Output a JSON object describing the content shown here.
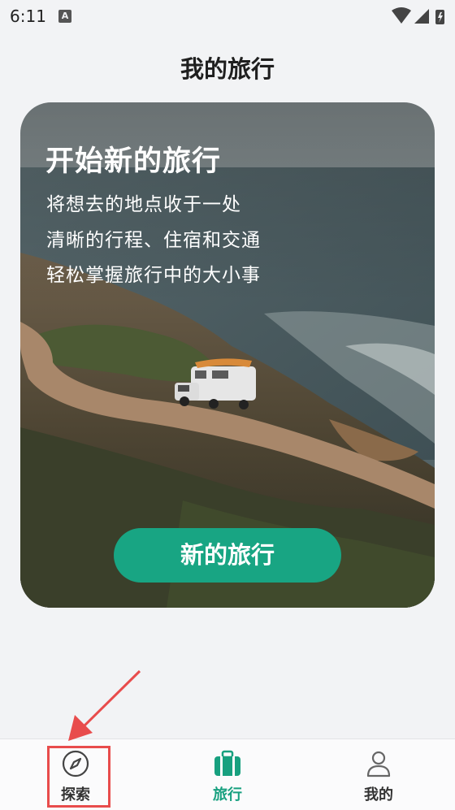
{
  "status_bar": {
    "time": "6:11",
    "notification_badge": "A"
  },
  "header": {
    "title": "我的旅行"
  },
  "hero": {
    "title": "开始新的旅行",
    "lines": [
      "将想去的地点收于一处",
      "清晰的行程、住宿和交通",
      "轻松掌握旅行中的大小事"
    ],
    "button_label": "新的旅行"
  },
  "bottom_nav": {
    "items": [
      {
        "label": "探索",
        "icon": "compass-icon"
      },
      {
        "label": "旅行",
        "icon": "suitcase-icon",
        "active": true
      },
      {
        "label": "我的",
        "icon": "person-icon"
      }
    ]
  },
  "colors": {
    "accent": "#18a583",
    "active_tab": "#17a07f",
    "annotation": "#e84c4c",
    "background": "#f2f3f5"
  }
}
